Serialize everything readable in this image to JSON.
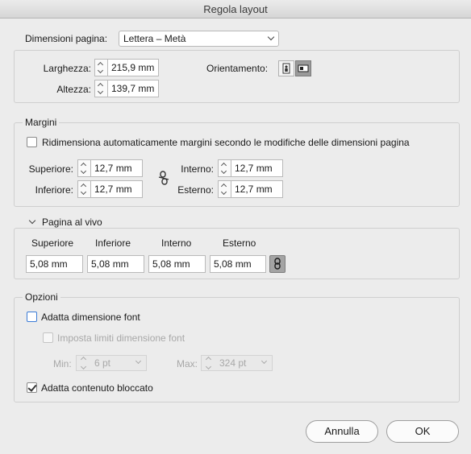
{
  "window": {
    "title": "Regola layout"
  },
  "page_size": {
    "label": "Dimensioni pagina:",
    "preset": "Lettera – Metà",
    "width_label": "Larghezza:",
    "width_value": "215,9 mm",
    "height_label": "Altezza:",
    "height_value": "139,7 mm",
    "orientation_label": "Orientamento:"
  },
  "margins": {
    "title": "Margini",
    "auto_resize_label": "Ridimensiona automaticamente margini secondo le modifiche delle dimensioni pagina",
    "top_label": "Superiore:",
    "top_value": "12,7 mm",
    "bottom_label": "Inferiore:",
    "bottom_value": "12,7 mm",
    "inside_label": "Interno:",
    "inside_value": "12,7 mm",
    "outside_label": "Esterno:",
    "outside_value": "12,7 mm"
  },
  "bleed": {
    "title": "Pagina al vivo",
    "top_label": "Superiore",
    "top_value": "5,08 mm",
    "bottom_label": "Inferiore",
    "bottom_value": "5,08 mm",
    "inside_label": "Interno",
    "inside_value": "5,08 mm",
    "outside_label": "Esterno",
    "outside_value": "5,08 mm"
  },
  "options": {
    "title": "Opzioni",
    "adjust_font_label": "Adatta dimensione font",
    "set_font_limits_label": "Imposta limiti dimensione font",
    "min_label": "Min:",
    "min_value": "6 pt",
    "max_label": "Max:",
    "max_value": "324 pt",
    "adjust_locked_label": "Adatta contenuto bloccato"
  },
  "buttons": {
    "cancel": "Annulla",
    "ok": "OK"
  }
}
